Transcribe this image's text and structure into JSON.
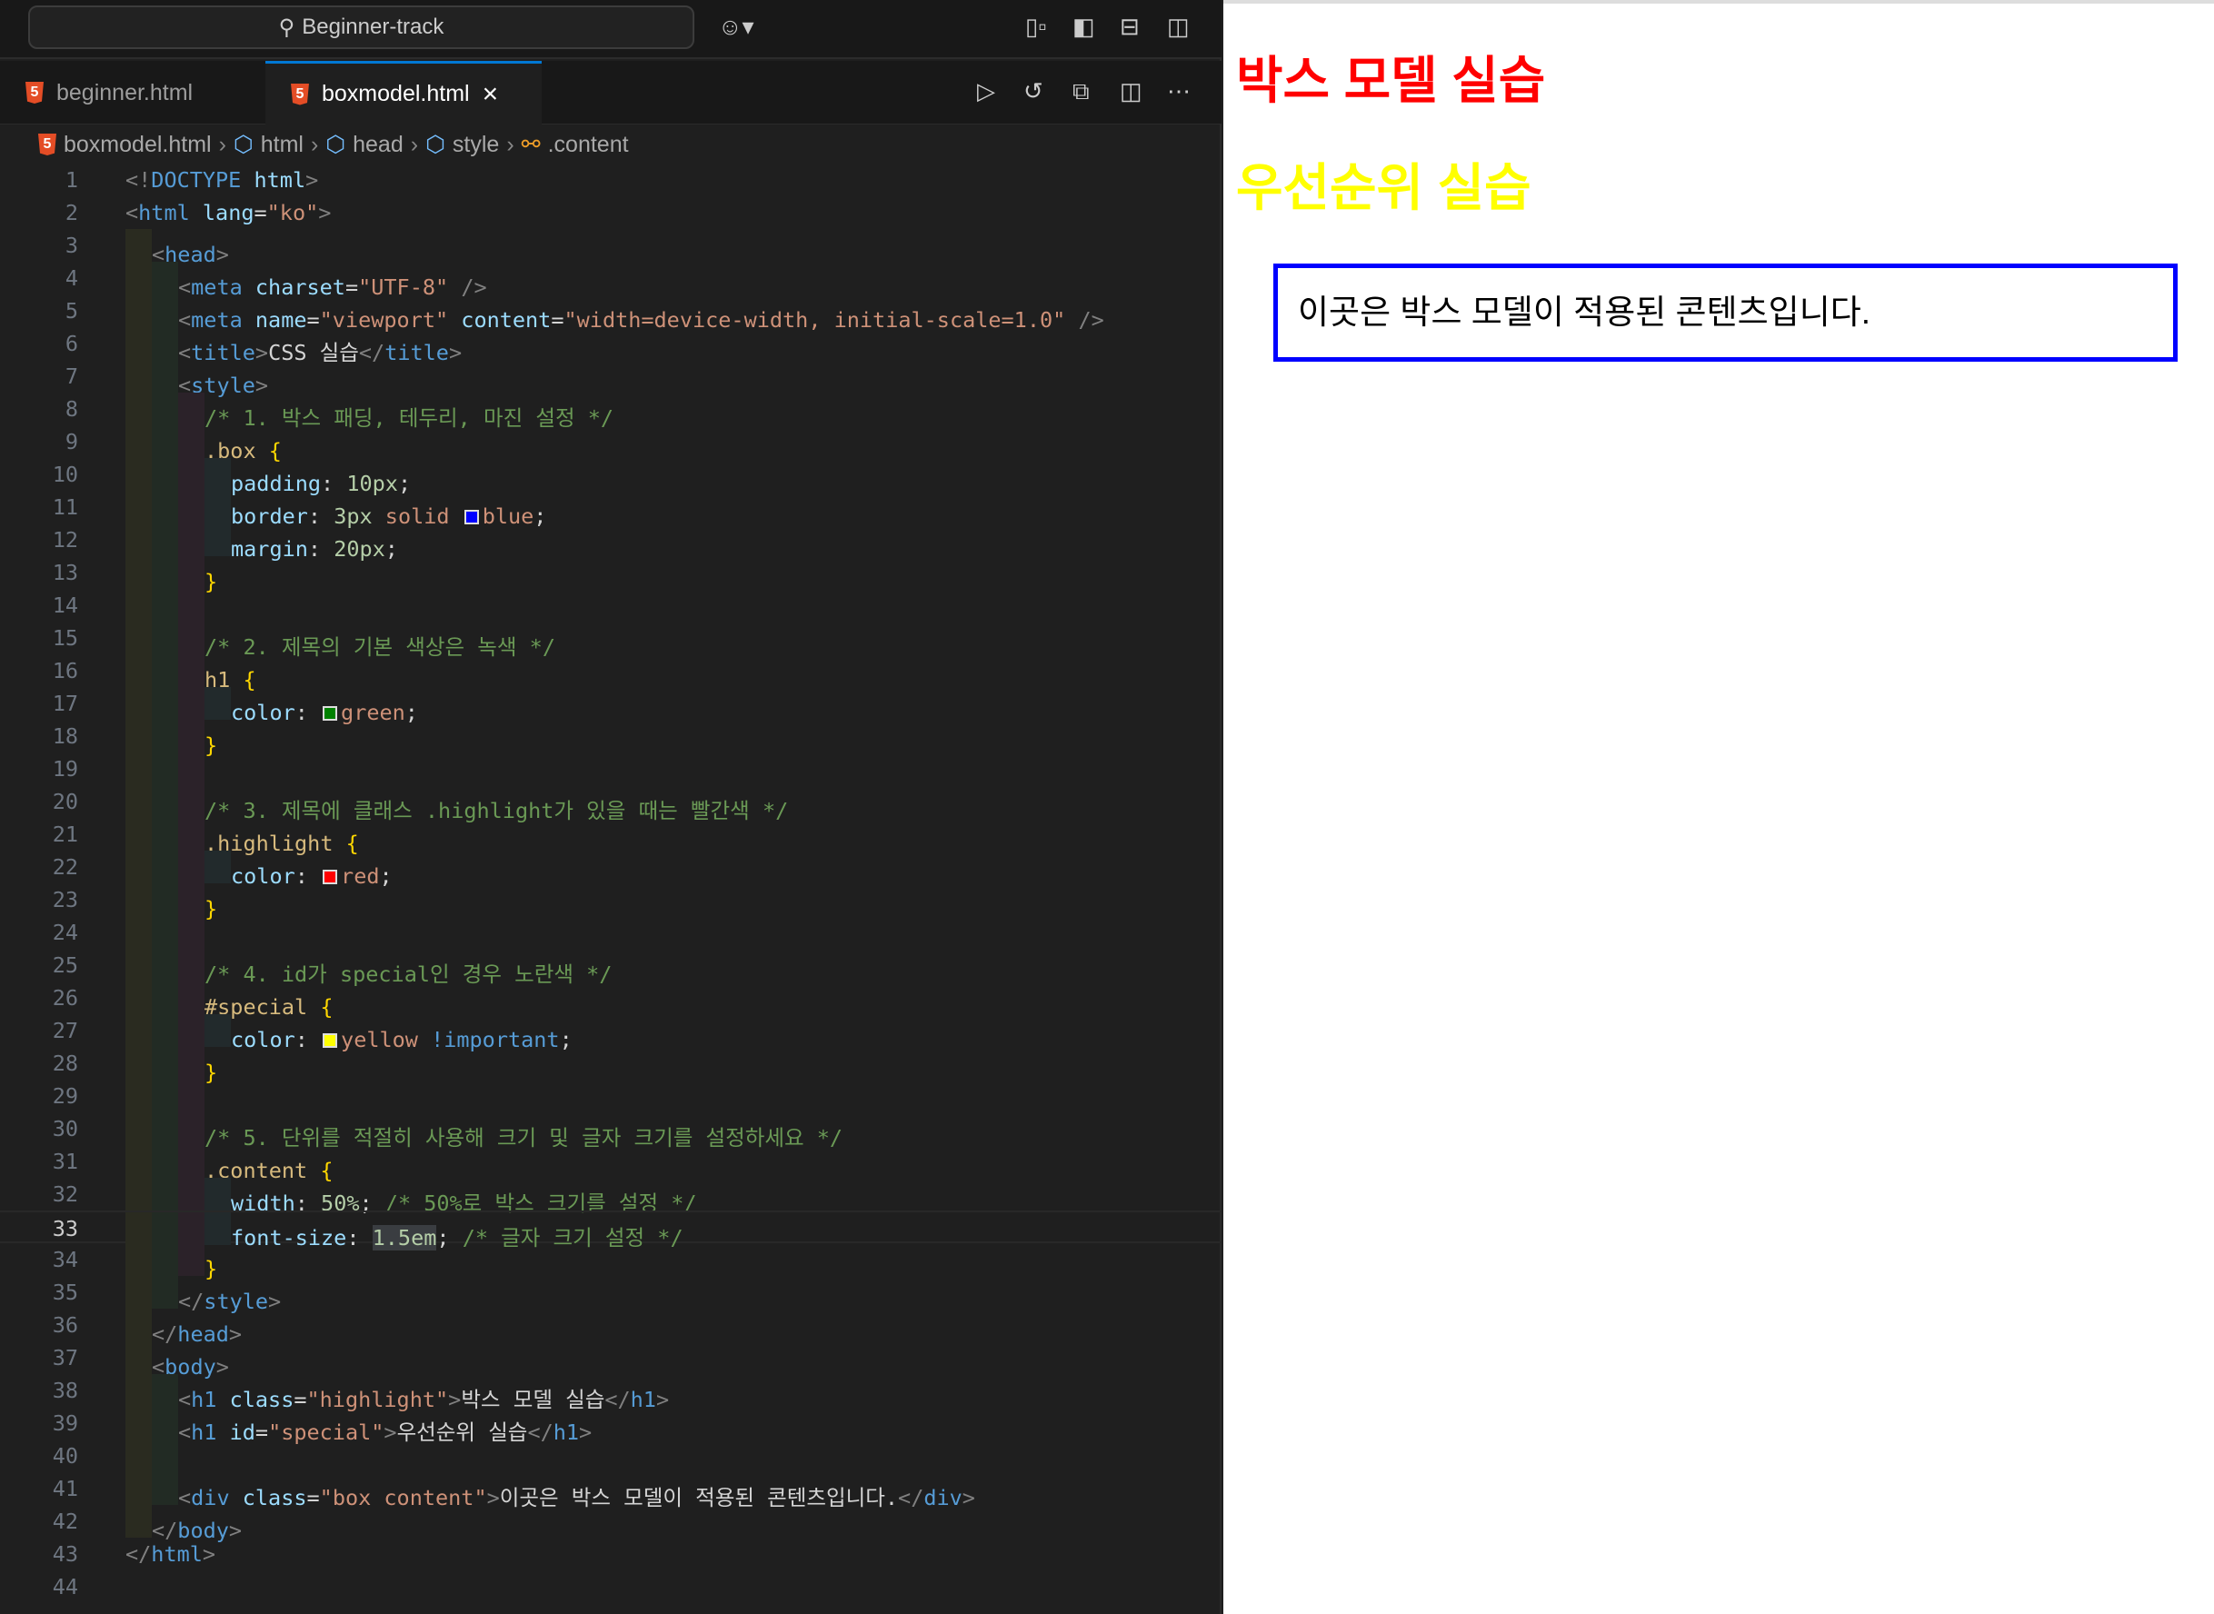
{
  "titlebar": {
    "search": "Beginner-track"
  },
  "tabs": [
    {
      "label": "beginner.html"
    },
    {
      "label": "boxmodel.html",
      "close": "×"
    }
  ],
  "breadcrumb": [
    "boxmodel.html",
    "html",
    "head",
    "style",
    ".content"
  ],
  "colors": {
    "accent": "#0078d4",
    "h1_highlight": "#ff0000",
    "h1_special": "#ffff00",
    "box_border": "#0000ff"
  },
  "current_line": 33,
  "code": [
    {
      "i": 0,
      "k": [
        [
          "p",
          "<!"
        ],
        [
          "t",
          "DOCTYPE"
        ],
        [
          "x",
          " "
        ],
        [
          "a",
          "html"
        ],
        [
          "p",
          ">"
        ]
      ]
    },
    {
      "i": 0,
      "k": [
        [
          "p",
          "<"
        ],
        [
          "t",
          "html"
        ],
        [
          "x",
          " "
        ],
        [
          "a",
          "lang"
        ],
        [
          "x",
          "="
        ],
        [
          "s",
          "\"ko\""
        ],
        [
          "p",
          ">"
        ]
      ]
    },
    {
      "i": 1,
      "k": [
        [
          "p",
          "<"
        ],
        [
          "t",
          "head"
        ],
        [
          "p",
          ">"
        ]
      ]
    },
    {
      "i": 2,
      "k": [
        [
          "p",
          "<"
        ],
        [
          "t",
          "meta"
        ],
        [
          "x",
          " "
        ],
        [
          "a",
          "charset"
        ],
        [
          "x",
          "="
        ],
        [
          "s",
          "\"UTF-8\""
        ],
        [
          "x",
          " "
        ],
        [
          "p",
          "/>"
        ]
      ]
    },
    {
      "i": 2,
      "k": [
        [
          "p",
          "<"
        ],
        [
          "t",
          "meta"
        ],
        [
          "x",
          " "
        ],
        [
          "a",
          "name"
        ],
        [
          "x",
          "="
        ],
        [
          "s",
          "\"viewport\""
        ],
        [
          "x",
          " "
        ],
        [
          "a",
          "content"
        ],
        [
          "x",
          "="
        ],
        [
          "s",
          "\"width=device-width, initial-scale=1.0\""
        ],
        [
          "x",
          " "
        ],
        [
          "p",
          "/>"
        ]
      ]
    },
    {
      "i": 2,
      "k": [
        [
          "p",
          "<"
        ],
        [
          "t",
          "title"
        ],
        [
          "p",
          ">"
        ],
        [
          "x",
          "CSS 실습"
        ],
        [
          "p",
          "</"
        ],
        [
          "t",
          "title"
        ],
        [
          "p",
          ">"
        ]
      ]
    },
    {
      "i": 2,
      "k": [
        [
          "p",
          "<"
        ],
        [
          "t",
          "style"
        ],
        [
          "p",
          ">"
        ]
      ]
    },
    {
      "i": 3,
      "k": [
        [
          "c",
          "/* 1. 박스 패딩, 테두리, 마진 설정 */"
        ]
      ]
    },
    {
      "i": 3,
      "k": [
        [
          "sel",
          ".box"
        ],
        [
          "x",
          " "
        ],
        [
          "b",
          "{"
        ]
      ]
    },
    {
      "i": 4,
      "k": [
        [
          "a",
          "padding"
        ],
        [
          "x",
          ": "
        ],
        [
          "n",
          "10px"
        ],
        [
          "x",
          ";"
        ]
      ]
    },
    {
      "i": 4,
      "k": [
        [
          "a",
          "border"
        ],
        [
          "x",
          ": "
        ],
        [
          "n",
          "3px"
        ],
        [
          "x",
          " "
        ],
        [
          "s",
          "solid"
        ],
        [
          "x",
          " "
        ],
        [
          "sw",
          "#0000ff"
        ],
        [
          "s",
          "blue"
        ],
        [
          "x",
          ";"
        ]
      ]
    },
    {
      "i": 4,
      "k": [
        [
          "a",
          "margin"
        ],
        [
          "x",
          ": "
        ],
        [
          "n",
          "20px"
        ],
        [
          "x",
          ";"
        ]
      ]
    },
    {
      "i": 3,
      "k": [
        [
          "b",
          "}"
        ]
      ]
    },
    {
      "i": 3,
      "k": []
    },
    {
      "i": 3,
      "k": [
        [
          "c",
          "/* 2. 제목의 기본 색상은 녹색 */"
        ]
      ]
    },
    {
      "i": 3,
      "k": [
        [
          "sel",
          "h1"
        ],
        [
          "x",
          " "
        ],
        [
          "b",
          "{"
        ]
      ]
    },
    {
      "i": 4,
      "k": [
        [
          "a",
          "color"
        ],
        [
          "x",
          ": "
        ],
        [
          "sw",
          "#008000"
        ],
        [
          "s",
          "green"
        ],
        [
          "x",
          ";"
        ]
      ]
    },
    {
      "i": 3,
      "k": [
        [
          "b",
          "}"
        ]
      ]
    },
    {
      "i": 3,
      "k": []
    },
    {
      "i": 3,
      "k": [
        [
          "c",
          "/* 3. 제목에 클래스 .highlight가 있을 때는 빨간색 */"
        ]
      ]
    },
    {
      "i": 3,
      "k": [
        [
          "sel",
          ".highlight"
        ],
        [
          "x",
          " "
        ],
        [
          "b",
          "{"
        ]
      ]
    },
    {
      "i": 4,
      "k": [
        [
          "a",
          "color"
        ],
        [
          "x",
          ": "
        ],
        [
          "sw",
          "#ff0000"
        ],
        [
          "s",
          "red"
        ],
        [
          "x",
          ";"
        ]
      ]
    },
    {
      "i": 3,
      "k": [
        [
          "b",
          "}"
        ]
      ]
    },
    {
      "i": 3,
      "k": []
    },
    {
      "i": 3,
      "k": [
        [
          "c",
          "/* 4. id가 special인 경우 노란색 */"
        ]
      ]
    },
    {
      "i": 3,
      "k": [
        [
          "sel",
          "#special"
        ],
        [
          "x",
          " "
        ],
        [
          "b",
          "{"
        ]
      ]
    },
    {
      "i": 4,
      "k": [
        [
          "a",
          "color"
        ],
        [
          "x",
          ": "
        ],
        [
          "sw",
          "#ffff00"
        ],
        [
          "s",
          "yellow"
        ],
        [
          "x",
          " "
        ],
        [
          "k",
          "!important"
        ],
        [
          "x",
          ";"
        ]
      ]
    },
    {
      "i": 3,
      "k": [
        [
          "b",
          "}"
        ]
      ]
    },
    {
      "i": 3,
      "k": []
    },
    {
      "i": 3,
      "k": [
        [
          "c",
          "/* 5. 단위를 적절히 사용해 크기 및 글자 크기를 설정하세요 */"
        ]
      ]
    },
    {
      "i": 3,
      "k": [
        [
          "sel",
          ".content"
        ],
        [
          "x",
          " "
        ],
        [
          "b",
          "{"
        ]
      ]
    },
    {
      "i": 4,
      "k": [
        [
          "a",
          "width"
        ],
        [
          "x",
          ": "
        ],
        [
          "n",
          "50%"
        ],
        [
          "x",
          "; "
        ],
        [
          "c",
          "/* 50%로 박스 크기를 설정 */"
        ]
      ]
    },
    {
      "i": 4,
      "k": [
        [
          "a",
          "font-size"
        ],
        [
          "x",
          ": "
        ],
        [
          "nh",
          "1.5em"
        ],
        [
          "x",
          "; "
        ],
        [
          "c",
          "/* 글자 크기 설정 */"
        ]
      ]
    },
    {
      "i": 3,
      "k": [
        [
          "b",
          "}"
        ]
      ]
    },
    {
      "i": 2,
      "k": [
        [
          "p",
          "</"
        ],
        [
          "t",
          "style"
        ],
        [
          "p",
          ">"
        ]
      ]
    },
    {
      "i": 1,
      "k": [
        [
          "p",
          "</"
        ],
        [
          "t",
          "head"
        ],
        [
          "p",
          ">"
        ]
      ]
    },
    {
      "i": 1,
      "k": [
        [
          "p",
          "<"
        ],
        [
          "t",
          "body"
        ],
        [
          "p",
          ">"
        ]
      ]
    },
    {
      "i": 2,
      "k": [
        [
          "p",
          "<"
        ],
        [
          "t",
          "h1"
        ],
        [
          "x",
          " "
        ],
        [
          "a",
          "class"
        ],
        [
          "x",
          "="
        ],
        [
          "s",
          "\"highlight\""
        ],
        [
          "p",
          ">"
        ],
        [
          "x",
          "박스 모델 실습"
        ],
        [
          "p",
          "</"
        ],
        [
          "t",
          "h1"
        ],
        [
          "p",
          ">"
        ]
      ]
    },
    {
      "i": 2,
      "k": [
        [
          "p",
          "<"
        ],
        [
          "t",
          "h1"
        ],
        [
          "x",
          " "
        ],
        [
          "a",
          "id"
        ],
        [
          "x",
          "="
        ],
        [
          "s",
          "\"special\""
        ],
        [
          "p",
          ">"
        ],
        [
          "x",
          "우선순위 실습"
        ],
        [
          "p",
          "</"
        ],
        [
          "t",
          "h1"
        ],
        [
          "p",
          ">"
        ]
      ]
    },
    {
      "i": 2,
      "k": []
    },
    {
      "i": 2,
      "k": [
        [
          "p",
          "<"
        ],
        [
          "t",
          "div"
        ],
        [
          "x",
          " "
        ],
        [
          "a",
          "class"
        ],
        [
          "x",
          "="
        ],
        [
          "s",
          "\"box content\""
        ],
        [
          "p",
          ">"
        ],
        [
          "x",
          "이곳은 박스 모델이 적용된 콘텐츠입니다."
        ],
        [
          "p",
          "</"
        ],
        [
          "t",
          "div"
        ],
        [
          "p",
          ">"
        ]
      ]
    },
    {
      "i": 1,
      "k": [
        [
          "p",
          "</"
        ],
        [
          "t",
          "body"
        ],
        [
          "p",
          ">"
        ]
      ]
    },
    {
      "i": 0,
      "k": [
        [
          "p",
          "</"
        ],
        [
          "t",
          "html"
        ],
        [
          "p",
          ">"
        ]
      ]
    },
    {
      "i": 0,
      "k": []
    }
  ],
  "preview": {
    "h1_highlight": "박스 모델 실습",
    "h1_special": "우선순위 실습",
    "box_text": "이곳은 박스 모델이 적용된 콘텐츠입니다."
  }
}
